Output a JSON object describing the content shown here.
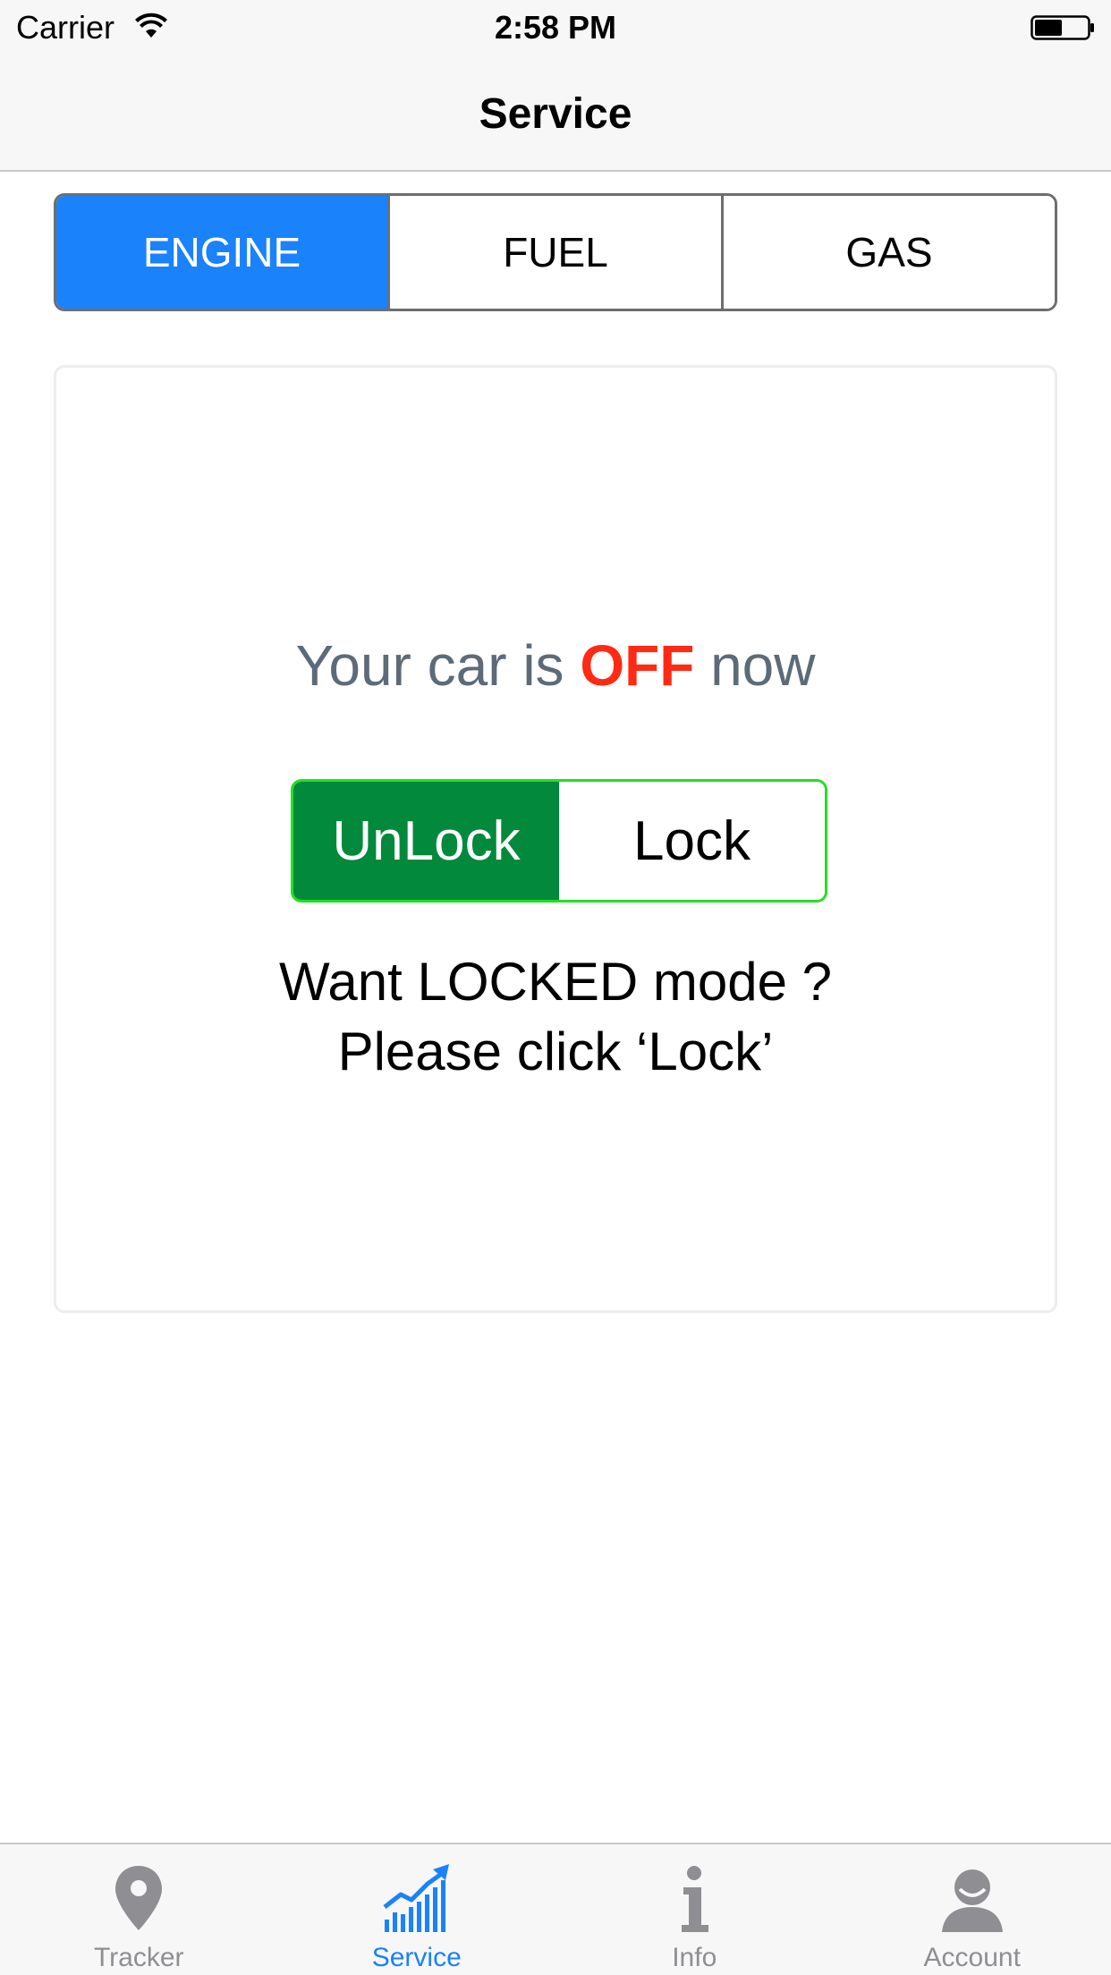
{
  "status_bar": {
    "carrier": "Carrier",
    "time": "2:58 PM"
  },
  "nav": {
    "title": "Service"
  },
  "segments": [
    {
      "label": "ENGINE",
      "selected": true
    },
    {
      "label": "FUEL",
      "selected": false
    },
    {
      "label": "GAS",
      "selected": false
    }
  ],
  "engine_card": {
    "status_prefix": "Your car is",
    "status_value": "OFF",
    "status_suffix": "now",
    "toggle": {
      "unlock_label": "UnLock",
      "lock_label": "Lock",
      "selected": "UnLock"
    },
    "hint_line1": "Want LOCKED mode ?",
    "hint_line2": "Please click ‘Lock’"
  },
  "tabs": [
    {
      "label": "Tracker",
      "icon": "location-pin-icon",
      "selected": false
    },
    {
      "label": "Service",
      "icon": "chart-growth-icon",
      "selected": true
    },
    {
      "label": "Info",
      "icon": "info-icon",
      "selected": false
    },
    {
      "label": "Account",
      "icon": "account-icon",
      "selected": false
    }
  ],
  "colors": {
    "accent": "#1a82fb",
    "off_status": "#ff2a13",
    "unlock_active": "#03893b",
    "toggle_border": "#22e022"
  }
}
